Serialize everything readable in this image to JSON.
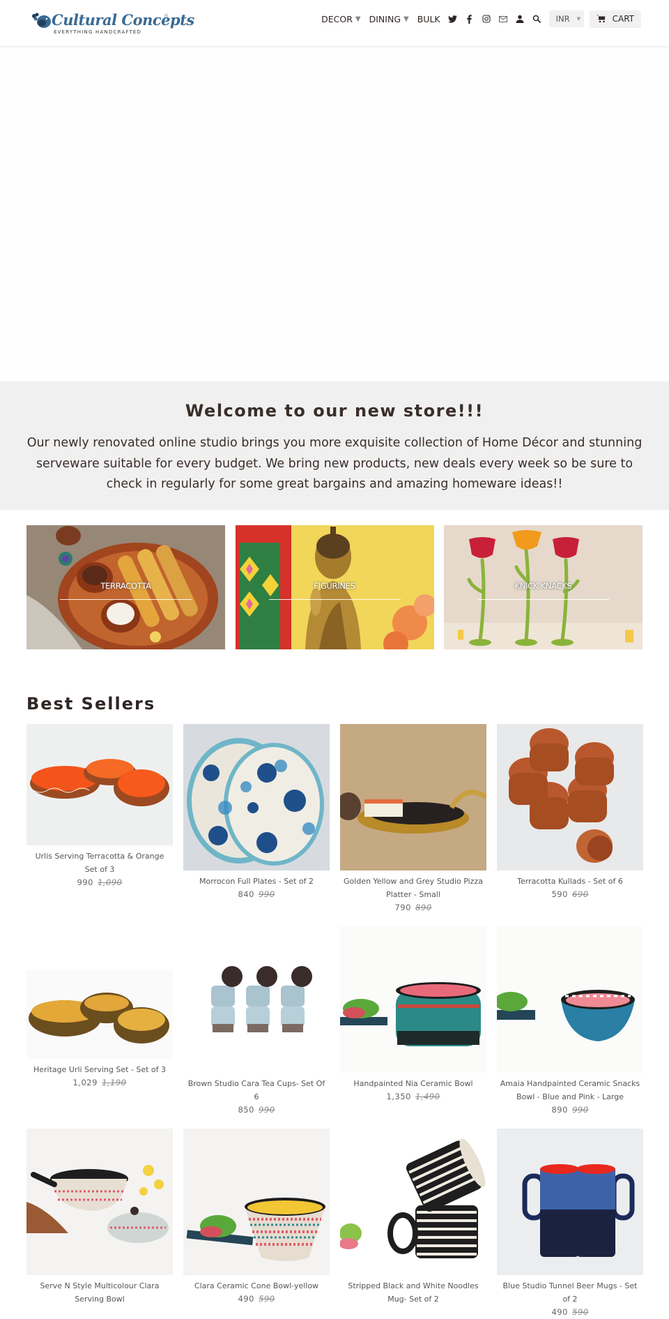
{
  "brand": {
    "name": "Cultural Concepts",
    "tagline": "EVERYTHING HANDCRAFTED",
    "reg_mark": "®",
    "color": "#3a6a93"
  },
  "nav": {
    "items": [
      {
        "label": "DECOR",
        "has_dropdown": true,
        "caret": "▼"
      },
      {
        "label": "DINING",
        "has_dropdown": true,
        "caret": "▼"
      },
      {
        "label": "BULK",
        "has_dropdown": false
      }
    ],
    "icons": [
      "twitter-icon",
      "facebook-icon",
      "instagram-icon",
      "email-icon",
      "account-icon",
      "search-icon"
    ],
    "currency": {
      "selected": "INR",
      "caret": "▾"
    },
    "cart_label": "CART"
  },
  "welcome": {
    "title": "Welcome to our new store!!!",
    "body": "Our newly renovated online studio brings you more exquisite collection of Home Décor and stunning serveware suitable for every budget. We  bring  new products, new deals  every week so be sure to check in regularly for some great bargains and amazing homeware ideas!!"
  },
  "collections": [
    {
      "label": "TERRACOTTA"
    },
    {
      "label": "FIGURINES"
    },
    {
      "label": "KNICK KNACKS"
    }
  ],
  "best_sellers": {
    "title": "Best Sellers",
    "products": [
      {
        "name": "Urlis Serving Terracotta & Orange Set of 3",
        "price": "990",
        "compare_at": "1,090"
      },
      {
        "name": "Morrocon Full Plates - Set of 2",
        "price": "840",
        "compare_at": "990"
      },
      {
        "name": "Golden Yellow and Grey Studio Pizza Platter - Small",
        "price": "790",
        "compare_at": "890"
      },
      {
        "name": "Terracotta Kullads - Set of 6",
        "price": "590",
        "compare_at": "690"
      },
      {
        "name": "Heritage Urli Serving Set - Set of 3",
        "price": "1,029",
        "compare_at": "1,190"
      },
      {
        "name": "Brown Studio Cara Tea Cups- Set Of 6",
        "price": "850",
        "compare_at": "990"
      },
      {
        "name": "Handpainted Nia Ceramic Bowl",
        "price": "1,350",
        "compare_at": "1,490"
      },
      {
        "name": "Amaia Handpainted Ceramic Snacks Bowl - Blue and Pink - Large",
        "price": "890",
        "compare_at": "990"
      },
      {
        "name": "Serve N Style Multicolour Clara Serving Bowl",
        "price": "",
        "compare_at": ""
      },
      {
        "name": "Clara Ceramic Cone Bowl-yellow",
        "price": "490",
        "compare_at": "590"
      },
      {
        "name": "Stripped Black and White Noodles Mug- Set of 2",
        "price": "",
        "compare_at": ""
      },
      {
        "name": "Blue Studio Tunnel Beer Mugs - Set of 2",
        "price": "490",
        "compare_at": "590"
      }
    ]
  }
}
